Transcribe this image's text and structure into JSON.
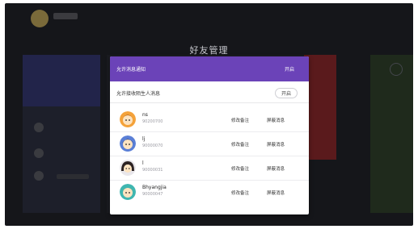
{
  "dialog": {
    "title": "好友管理",
    "setting_primary": {
      "label": "允许消息通知",
      "value": "开启"
    },
    "setting_secondary": {
      "label": "允许接收陌生人消息",
      "value": "开启"
    }
  },
  "friends": [
    {
      "name": "ns",
      "id": "90200700",
      "remark_label": "修改备注",
      "block_label": "屏蔽消息"
    },
    {
      "name": "lj",
      "id": "90000070",
      "remark_label": "修改备注",
      "block_label": "屏蔽消息"
    },
    {
      "name": "l",
      "id": "90000031",
      "remark_label": "修改备注",
      "block_label": "屏蔽消息"
    },
    {
      "name": "Bhyangjia",
      "id": "90000047",
      "remark_label": "修改备注",
      "block_label": "屏蔽消息"
    }
  ],
  "colors": {
    "accent": "#6b43b8",
    "backdrop": "#15161a",
    "dialog_bg": "#ffffff"
  },
  "icons": {
    "avatar_1": "cartoon-avatar-icon",
    "avatar_2": "cartoon-avatar-icon",
    "avatar_3": "cartoon-avatar-icon",
    "avatar_4": "cartoon-avatar-icon"
  }
}
